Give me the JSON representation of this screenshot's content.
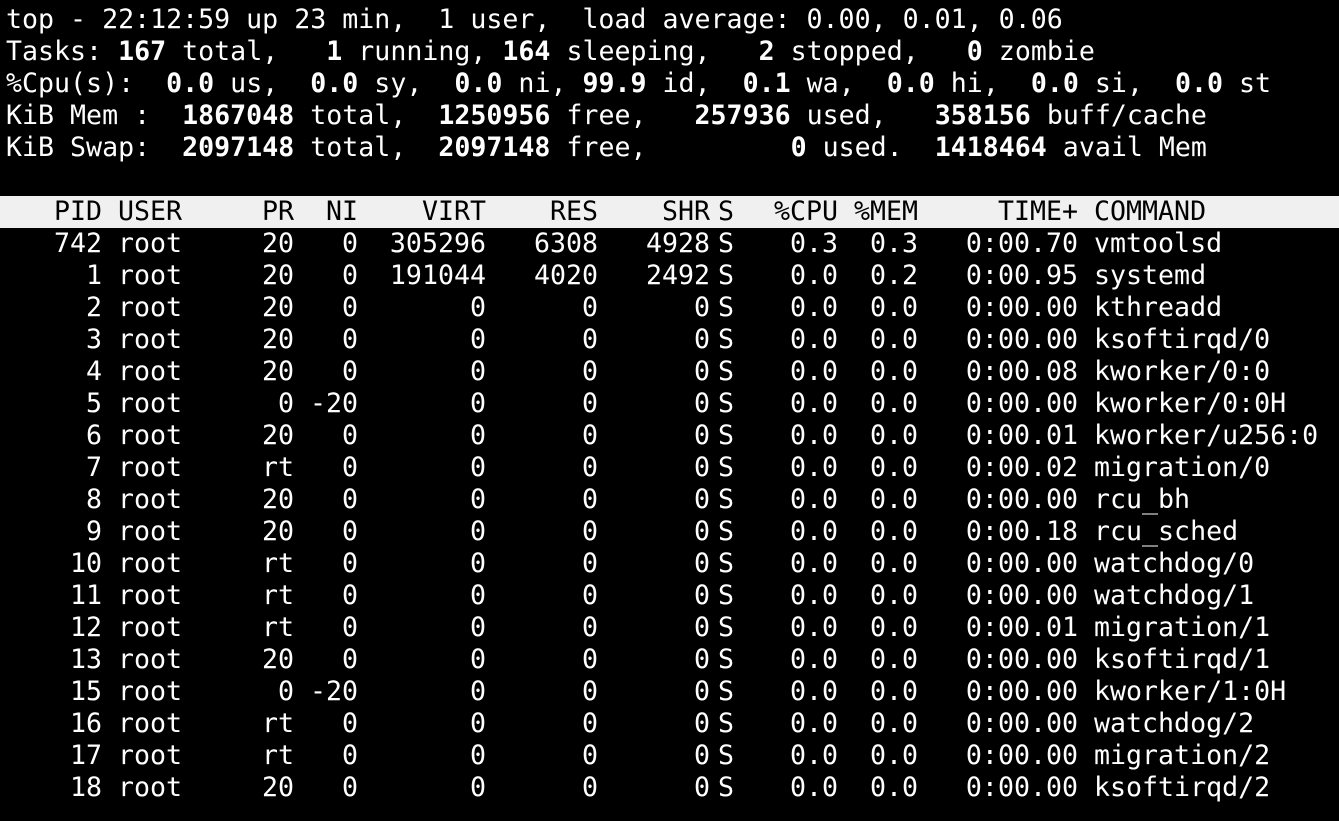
{
  "summary": {
    "line1": "top - 22:12:59 up 23 min,  1 user,  load average: 0.00, 0.01, 0.06",
    "tasks": {
      "label": "Tasks:",
      "total": "167",
      "total_label": " total,",
      "running": "1",
      "running_label": " running,",
      "sleeping": "164",
      "sleeping_label": " sleeping,",
      "stopped": "2",
      "stopped_label": " stopped,",
      "zombie": "0",
      "zombie_label": " zombie"
    },
    "cpu": {
      "label": "%Cpu(s):",
      "us": "0.0",
      "us_label": " us,",
      "sy": "0.0",
      "sy_label": " sy,",
      "ni": "0.0",
      "ni_label": " ni,",
      "id": "99.9",
      "id_label": " id,",
      "wa": "0.1",
      "wa_label": " wa,",
      "hi": "0.0",
      "hi_label": " hi,",
      "si": "0.0",
      "si_label": " si,",
      "st": "0.0",
      "st_label": " st"
    },
    "mem": {
      "label": "KiB Mem :",
      "total": "1867048",
      "total_label": " total,",
      "free": "1250956",
      "free_label": " free,",
      "used": "257936",
      "used_label": " used,",
      "buff": "358156",
      "buff_label": " buff/cache"
    },
    "swap": {
      "label": "KiB Swap:",
      "total": "2097148",
      "total_label": " total,",
      "free": "2097148",
      "free_label": " free,",
      "used": "0",
      "used_label": " used.",
      "avail": "1418464",
      "avail_label": " avail Mem"
    }
  },
  "columns": {
    "pid": "PID",
    "user": "USER",
    "pr": "PR",
    "ni": "NI",
    "virt": "VIRT",
    "res": "RES",
    "shr": "SHR",
    "s": "S",
    "cpu": "%CPU",
    "mem": "%MEM",
    "time": "TIME+",
    "command": "COMMAND"
  },
  "processes": [
    {
      "pid": "742",
      "user": "root",
      "pr": "20",
      "ni": "0",
      "virt": "305296",
      "res": "6308",
      "shr": "4928",
      "s": "S",
      "cpu": "0.3",
      "mem": "0.3",
      "time": "0:00.70",
      "command": "vmtoolsd"
    },
    {
      "pid": "1",
      "user": "root",
      "pr": "20",
      "ni": "0",
      "virt": "191044",
      "res": "4020",
      "shr": "2492",
      "s": "S",
      "cpu": "0.0",
      "mem": "0.2",
      "time": "0:00.95",
      "command": "systemd"
    },
    {
      "pid": "2",
      "user": "root",
      "pr": "20",
      "ni": "0",
      "virt": "0",
      "res": "0",
      "shr": "0",
      "s": "S",
      "cpu": "0.0",
      "mem": "0.0",
      "time": "0:00.00",
      "command": "kthreadd"
    },
    {
      "pid": "3",
      "user": "root",
      "pr": "20",
      "ni": "0",
      "virt": "0",
      "res": "0",
      "shr": "0",
      "s": "S",
      "cpu": "0.0",
      "mem": "0.0",
      "time": "0:00.00",
      "command": "ksoftirqd/0"
    },
    {
      "pid": "4",
      "user": "root",
      "pr": "20",
      "ni": "0",
      "virt": "0",
      "res": "0",
      "shr": "0",
      "s": "S",
      "cpu": "0.0",
      "mem": "0.0",
      "time": "0:00.08",
      "command": "kworker/0:0"
    },
    {
      "pid": "5",
      "user": "root",
      "pr": "0",
      "ni": "-20",
      "virt": "0",
      "res": "0",
      "shr": "0",
      "s": "S",
      "cpu": "0.0",
      "mem": "0.0",
      "time": "0:00.00",
      "command": "kworker/0:0H"
    },
    {
      "pid": "6",
      "user": "root",
      "pr": "20",
      "ni": "0",
      "virt": "0",
      "res": "0",
      "shr": "0",
      "s": "S",
      "cpu": "0.0",
      "mem": "0.0",
      "time": "0:00.01",
      "command": "kworker/u256:0"
    },
    {
      "pid": "7",
      "user": "root",
      "pr": "rt",
      "ni": "0",
      "virt": "0",
      "res": "0",
      "shr": "0",
      "s": "S",
      "cpu": "0.0",
      "mem": "0.0",
      "time": "0:00.02",
      "command": "migration/0"
    },
    {
      "pid": "8",
      "user": "root",
      "pr": "20",
      "ni": "0",
      "virt": "0",
      "res": "0",
      "shr": "0",
      "s": "S",
      "cpu": "0.0",
      "mem": "0.0",
      "time": "0:00.00",
      "command": "rcu_bh"
    },
    {
      "pid": "9",
      "user": "root",
      "pr": "20",
      "ni": "0",
      "virt": "0",
      "res": "0",
      "shr": "0",
      "s": "S",
      "cpu": "0.0",
      "mem": "0.0",
      "time": "0:00.18",
      "command": "rcu_sched"
    },
    {
      "pid": "10",
      "user": "root",
      "pr": "rt",
      "ni": "0",
      "virt": "0",
      "res": "0",
      "shr": "0",
      "s": "S",
      "cpu": "0.0",
      "mem": "0.0",
      "time": "0:00.00",
      "command": "watchdog/0"
    },
    {
      "pid": "11",
      "user": "root",
      "pr": "rt",
      "ni": "0",
      "virt": "0",
      "res": "0",
      "shr": "0",
      "s": "S",
      "cpu": "0.0",
      "mem": "0.0",
      "time": "0:00.00",
      "command": "watchdog/1"
    },
    {
      "pid": "12",
      "user": "root",
      "pr": "rt",
      "ni": "0",
      "virt": "0",
      "res": "0",
      "shr": "0",
      "s": "S",
      "cpu": "0.0",
      "mem": "0.0",
      "time": "0:00.01",
      "command": "migration/1"
    },
    {
      "pid": "13",
      "user": "root",
      "pr": "20",
      "ni": "0",
      "virt": "0",
      "res": "0",
      "shr": "0",
      "s": "S",
      "cpu": "0.0",
      "mem": "0.0",
      "time": "0:00.00",
      "command": "ksoftirqd/1"
    },
    {
      "pid": "15",
      "user": "root",
      "pr": "0",
      "ni": "-20",
      "virt": "0",
      "res": "0",
      "shr": "0",
      "s": "S",
      "cpu": "0.0",
      "mem": "0.0",
      "time": "0:00.00",
      "command": "kworker/1:0H"
    },
    {
      "pid": "16",
      "user": "root",
      "pr": "rt",
      "ni": "0",
      "virt": "0",
      "res": "0",
      "shr": "0",
      "s": "S",
      "cpu": "0.0",
      "mem": "0.0",
      "time": "0:00.00",
      "command": "watchdog/2"
    },
    {
      "pid": "17",
      "user": "root",
      "pr": "rt",
      "ni": "0",
      "virt": "0",
      "res": "0",
      "shr": "0",
      "s": "S",
      "cpu": "0.0",
      "mem": "0.0",
      "time": "0:00.00",
      "command": "migration/2"
    },
    {
      "pid": "18",
      "user": "root",
      "pr": "20",
      "ni": "0",
      "virt": "0",
      "res": "0",
      "shr": "0",
      "s": "S",
      "cpu": "0.0",
      "mem": "0.0",
      "time": "0:00.00",
      "command": "ksoftirqd/2"
    }
  ],
  "colors": {
    "background": "#000000",
    "foreground": "#ffffff",
    "header_bg": "#f0f0f0",
    "header_fg": "#000000"
  }
}
